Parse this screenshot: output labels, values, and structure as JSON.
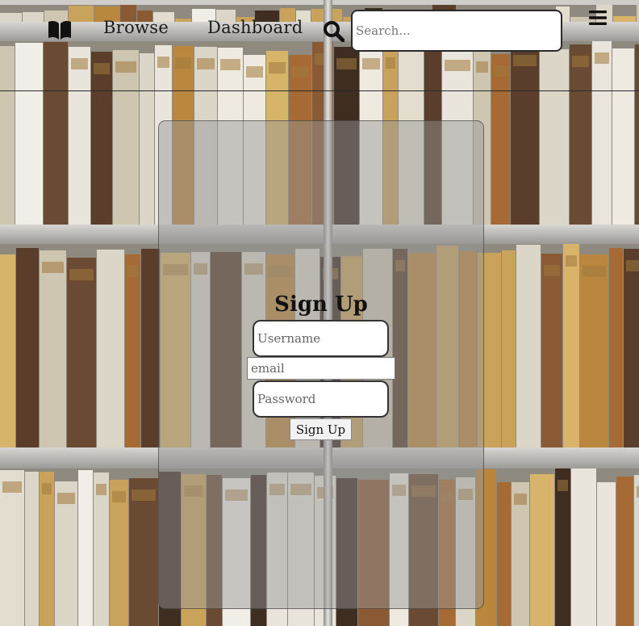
{
  "nav": {
    "logo_icon": "open-book-icon",
    "links": {
      "browse": "Browse",
      "dashboard": "Dashboard"
    },
    "search_icon": "magnifier-icon",
    "search_placeholder": "Search...",
    "menu_icon": "hamburger-icon"
  },
  "signup": {
    "title": "Sign Up",
    "username_placeholder": "Username",
    "email_placeholder": "email",
    "password_placeholder": "Password",
    "submit_label": "Sign Up"
  },
  "colors": {
    "panel_overlay": "#969696",
    "text": "#111111",
    "input_background": "#ffffff"
  }
}
